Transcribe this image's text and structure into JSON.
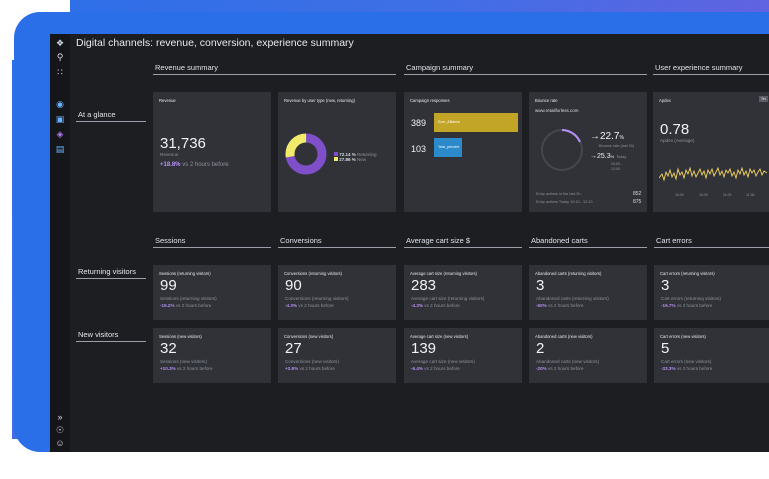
{
  "title": "Digital channels: revenue, conversion, experience summary",
  "sections": {
    "revenue_summary": "Revenue summary",
    "campaign_summary": "Campaign summary",
    "ux_summary": "User experience summary",
    "sessions": "Sessions",
    "conversions": "Conversions",
    "avg_cart": "Average cart size $",
    "abandoned": "Abandoned carts",
    "cart_errors": "Cart errors"
  },
  "rows": {
    "at_a_glance": "At a glance",
    "returning": "Returning visitors",
    "new": "New visitors"
  },
  "glance": {
    "revenue": {
      "title": "Revenue",
      "value": "31,736",
      "sub": "Revenue",
      "change": "+18.8%",
      "vs": "vs 2 hours before"
    },
    "by_user_type": {
      "title": "Revenue by user type (new, returning)",
      "legend": [
        {
          "pct": "72.14 %",
          "label": "Returning",
          "color": "#7f4fc9"
        },
        {
          "pct": "27.86 %",
          "label": "New",
          "color": "#f1ea6b"
        }
      ]
    },
    "campaign": {
      "title": "Campaign responses",
      "rows": [
        {
          "value": "389",
          "label": "Ever_Alliance",
          "color": "#c2a527"
        },
        {
          "value": "103",
          "label": "Year_percent",
          "color": "#2b8ac9"
        }
      ]
    },
    "bounce": {
      "title": "Bounce rate",
      "site": "www.retailforless.com",
      "v1": "22.7",
      "v1unit": "%",
      "v1label": "Bounce rate (last 2h)",
      "v2": "25.3",
      "v2unit": "%",
      "v2label": "Today",
      "v2extra1": "00:00 -",
      "v2extra2": "12:00",
      "e1_label": "Entry actions in the last 2h",
      "e1_value": "852",
      "e2_label": "Entry actions Today 10:10 - 12:10",
      "e2_value": "875"
    },
    "apdex": {
      "title": "Apdex",
      "badge": "Ter",
      "value": "0.78",
      "sub": "Apdex (Average)",
      "ticks": [
        "10:00",
        "10:30",
        "11:00",
        "11:30"
      ]
    }
  },
  "returning": [
    {
      "title": "Sessions (returning visitors)",
      "value": "99",
      "sub": "Sessions (returning visitors)",
      "change": "-15.2%",
      "vs": "vs 2 hours before"
    },
    {
      "title": "Conversions (returning visitors)",
      "value": "90",
      "sub": "Conversions (returning visitors)",
      "change": "-4.3%",
      "vs": "vs 2 hours before"
    },
    {
      "title": "Average cart size (returning visitors)",
      "value": "283",
      "sub": "Average cart size (returning visitors)",
      "change": "-4.3%",
      "vs": "vs 2 hours before"
    },
    {
      "title": "Abandoned carts (returning visitors)",
      "value": "3",
      "sub": "Abandoned carts (returning visitors)",
      "change": "-50%",
      "vs": "vs 2 hours before"
    },
    {
      "title": "Cart errors (returning visitors)",
      "value": "3",
      "sub": "Cart errors (returning visitors)",
      "change": "-16.7%",
      "vs": "vs 2 hours before"
    }
  ],
  "newv": [
    {
      "title": "Sessions (new visitors)",
      "value": "32",
      "sub": "Sessions (new visitors)",
      "change": "+10.3%",
      "vs": "vs 2 hours before"
    },
    {
      "title": "Conversions (new visitors)",
      "value": "27",
      "sub": "Conversions (new visitors)",
      "change": "+3.8%",
      "vs": "vs 2 hours before"
    },
    {
      "title": "Average cart size (new visitors)",
      "value": "139",
      "sub": "Average cart size (new visitors)",
      "change": "-6.4%",
      "vs": "vs 2 hours before"
    },
    {
      "title": "Abandoned carts (new visitors)",
      "value": "2",
      "sub": "Abandoned carts (new visitors)",
      "change": "-20%",
      "vs": "vs 2 hours before"
    },
    {
      "title": "Cart errors (new visitors)",
      "value": "5",
      "sub": "Cart errors (new visitors)",
      "change": "-33.3%",
      "vs": "vs 2 hours before"
    }
  ],
  "donut": {
    "returning": 72.14,
    "new": 27.86
  },
  "campaign_bars": {
    "max": 389
  },
  "icons": {
    "rail_top": [
      "logo-icon",
      "search-icon",
      "apps-grid-icon"
    ],
    "rail_mid": [
      "observe-icon",
      "monitor-icon",
      "shield-icon",
      "database-icon"
    ],
    "rail_bottom": [
      "expand-icon",
      "help-icon",
      "user-icon"
    ]
  },
  "colors": {
    "accent": "#b691f5",
    "returning": "#7f4fc9",
    "new": "#f1ea6b",
    "campaign1": "#c2a527",
    "campaign2": "#2b8ac9"
  }
}
